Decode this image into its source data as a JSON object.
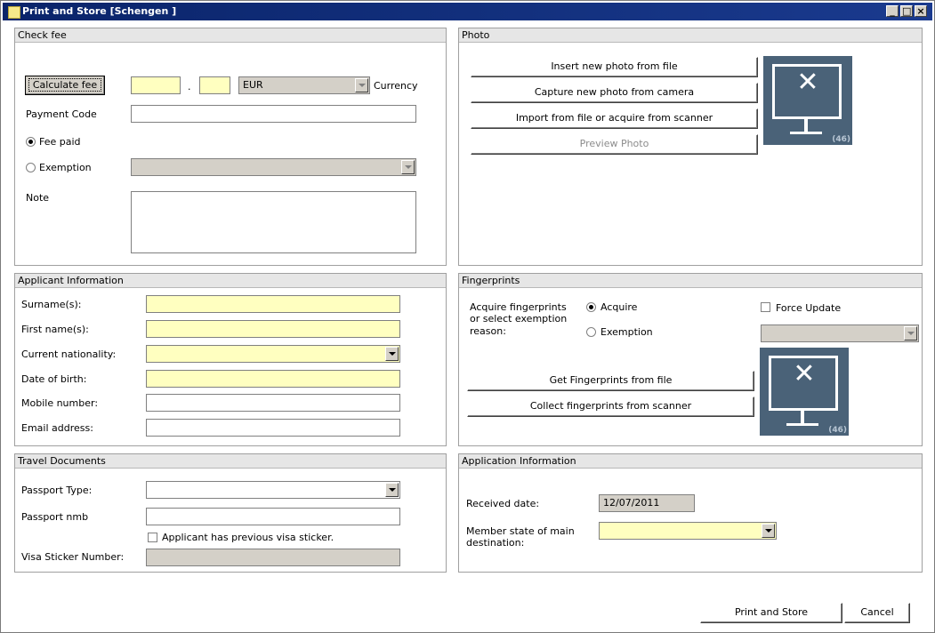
{
  "window": {
    "title": "Print and Store [Schengen ]"
  },
  "check_fee": {
    "header": "Check fee",
    "calculate_label": "Calculate fee",
    "fee_int": "",
    "fee_sep": ".",
    "fee_dec": "",
    "currency_value": "EUR",
    "currency_label": "Currency",
    "payment_code_label": "Payment Code",
    "payment_code_value": "",
    "fee_paid_label": "Fee paid",
    "exemption_label": "Exemption",
    "note_label": "Note"
  },
  "photo": {
    "header": "Photo",
    "insert_label": "Insert new photo from file",
    "capture_label": "Capture new photo from camera",
    "import_label": "Import from file or acquire from scanner",
    "preview_label": "Preview Photo",
    "placeholder_number": "(46)"
  },
  "applicant": {
    "header": "Applicant Information",
    "surname_label": "Surname(s):",
    "firstname_label": "First name(s):",
    "nationality_label": "Current nationality:",
    "dob_label": "Date of birth:",
    "mobile_label": "Mobile number:",
    "email_label": "Email address:"
  },
  "fingerprints": {
    "header": "Fingerprints",
    "prompt_line1": "Acquire fingerprints",
    "prompt_line2": "or select exemption",
    "prompt_line3": "reason:",
    "acquire_label": "Acquire",
    "exemption_label": "Exemption",
    "force_update_label": "Force Update",
    "get_file_label": "Get Fingerprints from file",
    "collect_scanner_label": "Collect fingerprints from scanner",
    "placeholder_number": "(46)"
  },
  "travel": {
    "header": "Travel Documents",
    "passport_type_label": "Passport Type:",
    "passport_nmb_label": "Passport nmb",
    "prev_visa_label": "Applicant has previous visa sticker.",
    "visa_sticker_label": "Visa Sticker Number:"
  },
  "application": {
    "header": "Application Information",
    "received_label": "Received date:",
    "received_value": "12/07/2011",
    "member_state_line1": "Member state of main",
    "member_state_line2": "destination:"
  },
  "footer": {
    "print_store_label": "Print and Store",
    "cancel_label": "Cancel"
  },
  "colors": {
    "required_field": "#ffffc0",
    "disabled_field": "#d4d0c8",
    "titlebar": "#0a246a",
    "photo_placeholder": "#4a6278"
  }
}
